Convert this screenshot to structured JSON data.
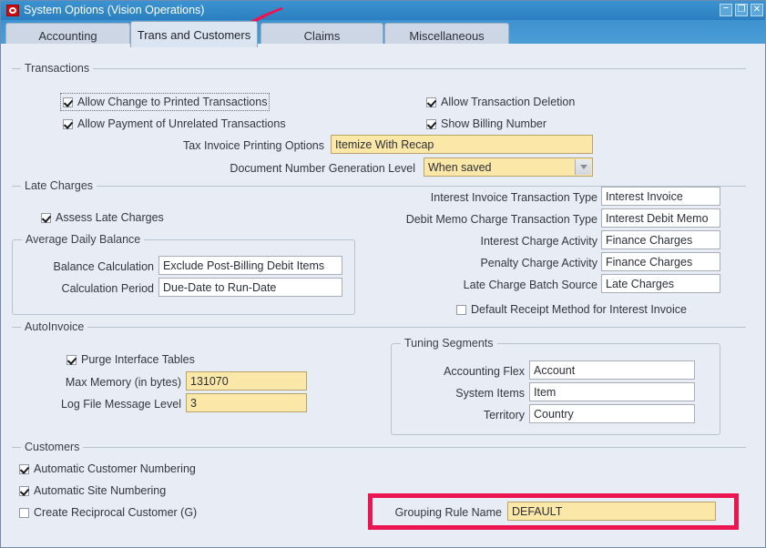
{
  "window": {
    "title": "System Options (Vision Operations)",
    "logo_icon": "oracle-logo-icon",
    "controls": {
      "minimize": "–",
      "maximize": "❐",
      "close": "✕"
    }
  },
  "tabs": [
    {
      "label": "Accounting",
      "active": false
    },
    {
      "label": "Trans and Customers",
      "active": true
    },
    {
      "label": "Claims",
      "active": false
    },
    {
      "label": "Miscellaneous",
      "active": false
    }
  ],
  "sections": {
    "transactions": {
      "title": "Transactions",
      "checkboxes": [
        {
          "label": "Allow Change to Printed Transactions",
          "checked": true,
          "focused": true
        },
        {
          "label": "Allow Payment of Unrelated Transactions",
          "checked": true,
          "focused": false
        },
        {
          "label": "Allow Transaction Deletion",
          "checked": true,
          "focused": false
        },
        {
          "label": "Show Billing Number",
          "checked": true,
          "focused": false
        }
      ],
      "fields": [
        {
          "label": "Tax Invoice Printing Options",
          "value": "Itemize With Recap",
          "style": "yellow",
          "type": "text"
        },
        {
          "label": "Document Number Generation Level",
          "value": "When saved",
          "style": "yellow",
          "type": "dropdown"
        }
      ]
    },
    "late_charges": {
      "title": "Late Charges",
      "assess_label": "Assess Late Charges",
      "assess_checked": true,
      "average_daily_balance": {
        "title": "Average Daily Balance",
        "fields": [
          {
            "label": "Balance Calculation",
            "value": "Exclude Post-Billing Debit Items"
          },
          {
            "label": "Calculation Period",
            "value": "Due-Date to Run-Date"
          }
        ]
      },
      "right_fields": [
        {
          "label": "Interest Invoice Transaction Type",
          "value": "Interest Invoice"
        },
        {
          "label": "Debit Memo Charge Transaction Type",
          "value": "Interest Debit Memo"
        },
        {
          "label": "Interest Charge Activity",
          "value": "Finance Charges"
        },
        {
          "label": "Penalty Charge Activity",
          "value": "Finance Charges"
        },
        {
          "label": "Late Charge Batch Source",
          "value": "Late Charges"
        }
      ],
      "default_receipt": {
        "label": "Default Receipt Method for Interest Invoice",
        "checked": false
      }
    },
    "autoinvoice": {
      "title": "AutoInvoice",
      "purge": {
        "label": "Purge Interface Tables",
        "checked": true
      },
      "fields": [
        {
          "label": "Max Memory (in bytes)",
          "value": "131070"
        },
        {
          "label": "Log File Message Level",
          "value": "3"
        }
      ],
      "tuning_segments": {
        "title": "Tuning Segments",
        "fields": [
          {
            "label": "Accounting Flex",
            "value": "Account"
          },
          {
            "label": "System Items",
            "value": "Item"
          },
          {
            "label": "Territory",
            "value": "Country"
          }
        ]
      }
    },
    "customers": {
      "title": "Customers",
      "checkboxes": [
        {
          "label": "Automatic Customer Numbering",
          "checked": true
        },
        {
          "label": "Automatic Site Numbering",
          "checked": true
        },
        {
          "label": "Create Reciprocal Customer (G)",
          "checked": false
        }
      ],
      "grouping_rule": {
        "label": "Grouping Rule Name",
        "value": "DEFAULT"
      }
    }
  },
  "annotations": {
    "arrow_icon": "red-arrow-pointer",
    "highlight_icon": "red-highlight-box",
    "accent_color": "#ec1552"
  }
}
